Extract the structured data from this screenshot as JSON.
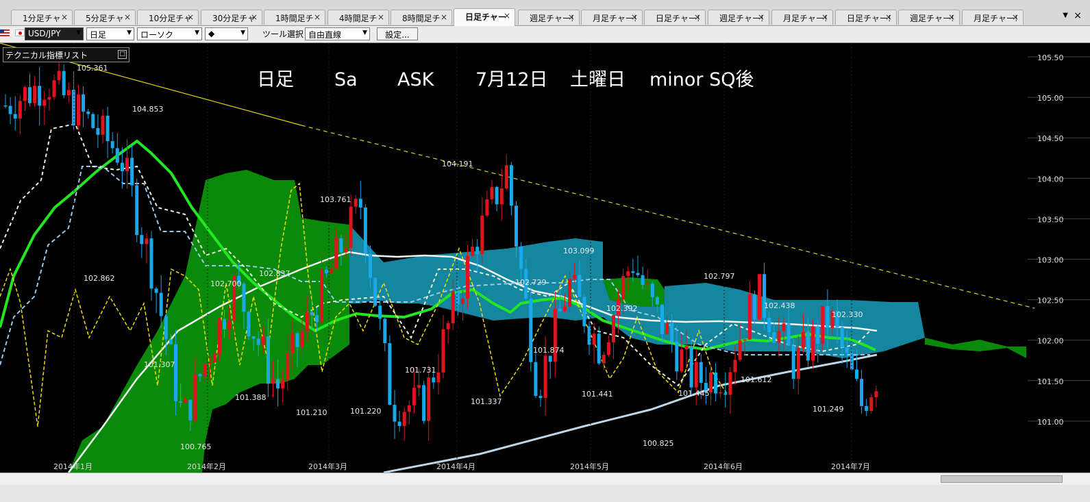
{
  "tabs": [
    {
      "label": "1分足チャ"
    },
    {
      "label": "5分足チャ"
    },
    {
      "label": "10分足チャ"
    },
    {
      "label": "30分足チャ"
    },
    {
      "label": "1時間足チ"
    },
    {
      "label": "4時間足チ"
    },
    {
      "label": "8時間足チ"
    },
    {
      "label": "日足チャー",
      "active": true
    },
    {
      "label": "週足チャー!"
    },
    {
      "label": "月足チャー!"
    },
    {
      "label": "日足チャー!"
    },
    {
      "label": "週足チャー!"
    },
    {
      "label": "月足チャー!"
    },
    {
      "label": "日足チャー!"
    },
    {
      "label": "週足チャー!"
    },
    {
      "label": "月足チャー!"
    }
  ],
  "tab_close_glyph": "×",
  "window": {
    "menu_glyph": "▼",
    "close_glyph": "×"
  },
  "toolbar": {
    "symbol": "USD/JPY",
    "timeframe": "日足",
    "chart_type": "ローソク",
    "line_style": "◆",
    "tool_label": "ツール選択",
    "tool_value": "自由直線",
    "settings_label": "設定..."
  },
  "indicator_panel": {
    "label": "テクニカル指標リスト",
    "toggle_glyph": "□"
  },
  "chart": {
    "title_parts": [
      "日足",
      "Sa",
      "ASK",
      "7月12日",
      "土曜日",
      "minor SQ後"
    ],
    "y_axis": {
      "ticks": [
        "105.50",
        "105.00",
        "104.50",
        "104.00",
        "103.50",
        "103.00",
        "102.50",
        "102.00",
        "101.50",
        "101.00"
      ]
    },
    "x_axis": {
      "ticks": [
        "2014年1月",
        "2014年2月",
        "2014年3月",
        "2014年4月",
        "2014年5月",
        "2014年6月",
        "2014年7月"
      ]
    },
    "price_labels": [
      "105.361",
      "104.853",
      "102.862",
      "101.307",
      "100.765",
      "102.700",
      "101.388",
      "102.837",
      "103.761",
      "101.210",
      "101.220",
      "104.191",
      "101.731",
      "101.337",
      "102.729",
      "101.874",
      "103.099",
      "102.392",
      "101.441",
      "100.825",
      "101.445",
      "102.797",
      "101.612",
      "102.438",
      "102.330",
      "101.249"
    ],
    "colors": {
      "background": "#000000",
      "bull": "#e0141e",
      "bear": "#19a8ea",
      "cloud_green": "#0a8a0a",
      "cloud_blue": "#14879f",
      "ma_green": "#22e622",
      "ma_white": "#f4f4f4",
      "ma_lightblue": "#bcd8e8",
      "trendline": "#e2d100",
      "oscillator": "#f0dc00"
    }
  }
}
